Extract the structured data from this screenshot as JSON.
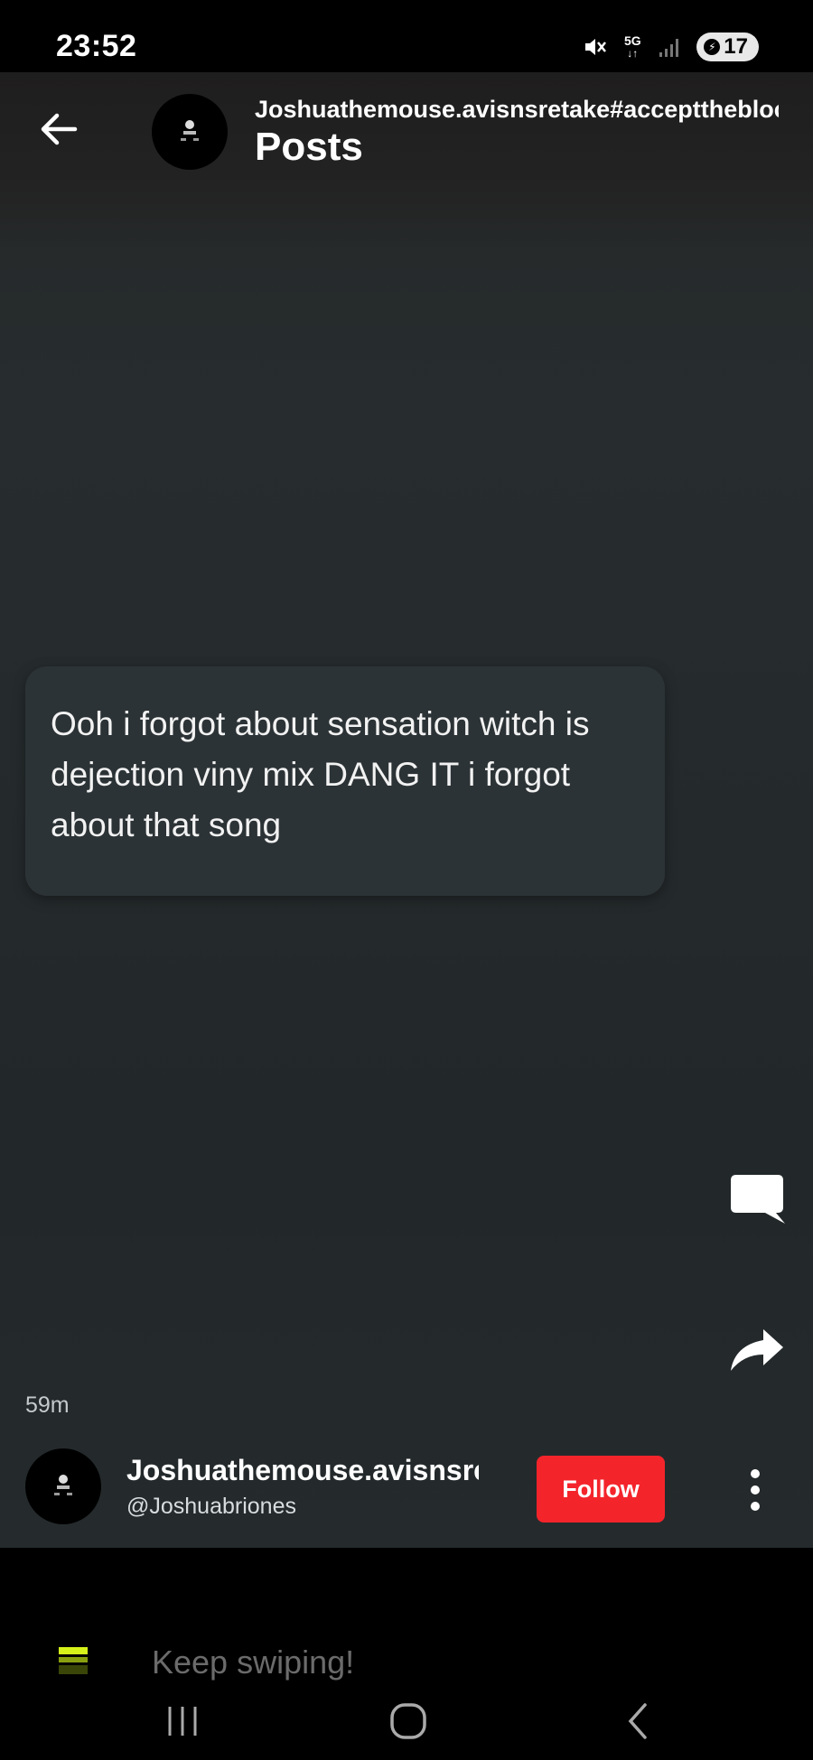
{
  "status_bar": {
    "time": "23:52",
    "network": "5G",
    "battery": "17",
    "icons": [
      "mute-icon",
      "signal-icon",
      "battery-icon"
    ]
  },
  "header": {
    "title": "Joshuathemouse.avisnsretake#accepttheblock",
    "subtitle": "Posts",
    "back_icon": "arrow-left-icon"
  },
  "post": {
    "text": "Ooh i forgot about sensation witch is dejection viny mix DANG IT i forgot about that song",
    "time_ago": "59m"
  },
  "actions": {
    "comment_icon": "comment-bubble-icon",
    "share_icon": "share-arrow-icon"
  },
  "author": {
    "name": "Joshuathemouse.avisnsretake",
    "handle": "@Joshuabriones",
    "follow_label": "Follow"
  },
  "bottom": {
    "keep_swiping": "Keep swiping!"
  },
  "colors": {
    "follow": "#f4242b",
    "card": "#2c3336",
    "background": "#252b2d"
  }
}
